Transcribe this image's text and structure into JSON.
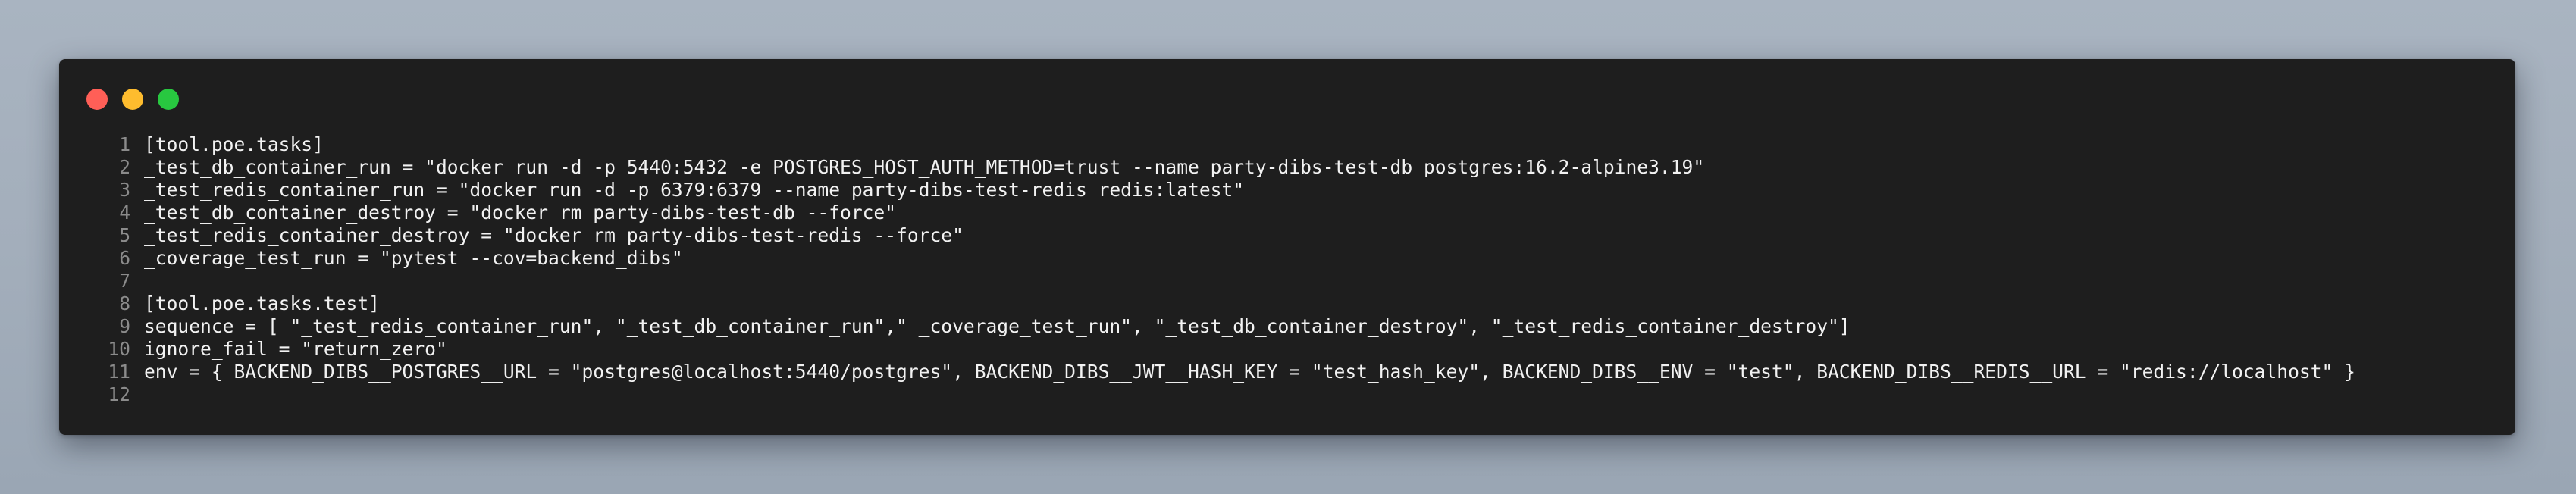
{
  "window": {
    "lights": [
      {
        "name": "close-button",
        "color": "#ff5f57"
      },
      {
        "name": "minimize-button",
        "color": "#febc2e"
      },
      {
        "name": "maximize-button",
        "color": "#28c840"
      }
    ]
  },
  "code": {
    "lines": [
      {
        "number": "1",
        "text": "[tool.poe.tasks]"
      },
      {
        "number": "2",
        "text": "_test_db_container_run = \"docker run -d -p 5440:5432 -e POSTGRES_HOST_AUTH_METHOD=trust --name party-dibs-test-db postgres:16.2-alpine3.19\""
      },
      {
        "number": "3",
        "text": "_test_redis_container_run = \"docker run -d -p 6379:6379 --name party-dibs-test-redis redis:latest\""
      },
      {
        "number": "4",
        "text": "_test_db_container_destroy = \"docker rm party-dibs-test-db --force\""
      },
      {
        "number": "5",
        "text": "_test_redis_container_destroy = \"docker rm party-dibs-test-redis --force\""
      },
      {
        "number": "6",
        "text": "_coverage_test_run = \"pytest --cov=backend_dibs\""
      },
      {
        "number": "7",
        "text": ""
      },
      {
        "number": "8",
        "text": "[tool.poe.tasks.test]"
      },
      {
        "number": "9",
        "text": "sequence = [ \"_test_redis_container_run\", \"_test_db_container_run\",\" _coverage_test_run\", \"_test_db_container_destroy\", \"_test_redis_container_destroy\"]"
      },
      {
        "number": "10",
        "text": "ignore_fail = \"return_zero\""
      },
      {
        "number": "11",
        "text": "env = { BACKEND_DIBS__POSTGRES__URL = \"postgres@localhost:5440/postgres\", BACKEND_DIBS__JWT__HASH_KEY = \"test_hash_key\", BACKEND_DIBS__ENV = \"test\", BACKEND_DIBS__REDIS__URL = \"redis://localhost\" }"
      },
      {
        "number": "12",
        "text": ""
      }
    ]
  }
}
